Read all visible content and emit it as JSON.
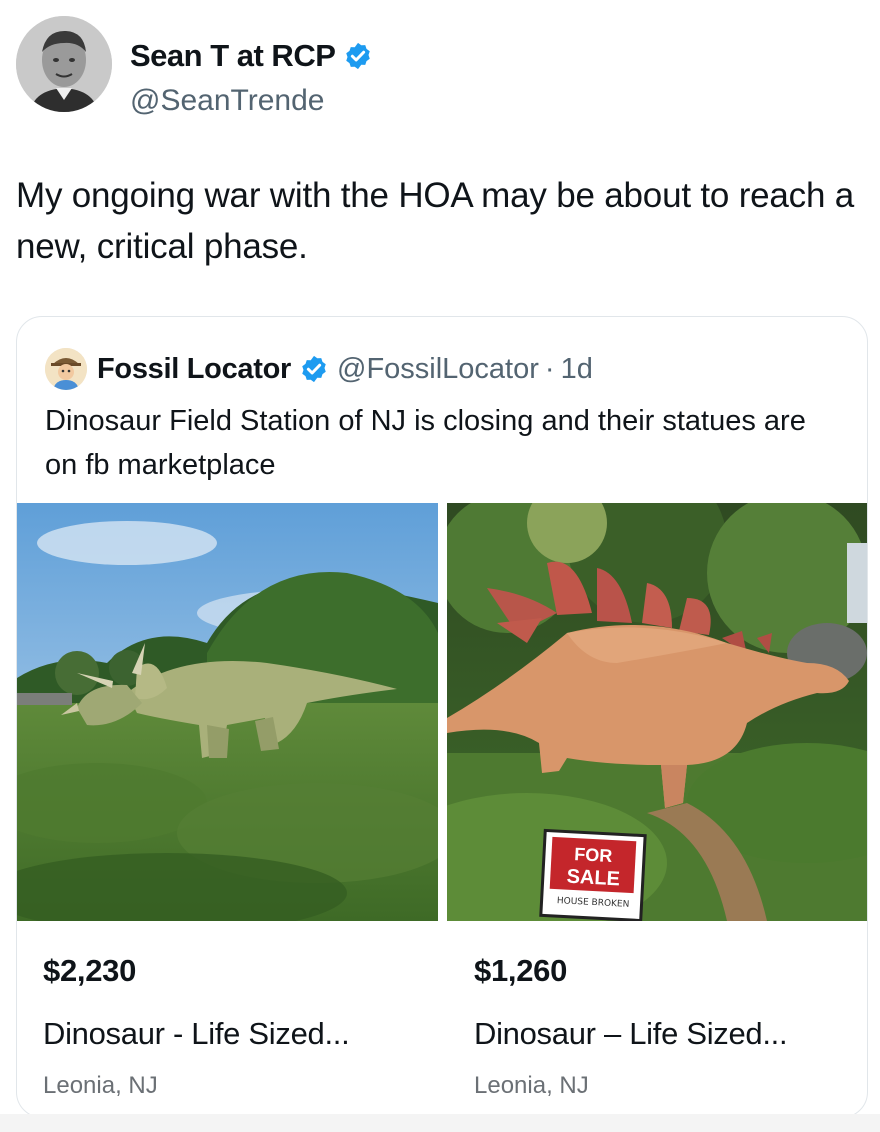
{
  "author": {
    "name": "Sean T at RCP",
    "handle": "@SeanTrende",
    "verified_color": "#1d9bf0"
  },
  "tweet": {
    "text": "My ongoing war with the HOA may be about to reach a new, critical phase."
  },
  "quoted_tweet": {
    "name": "Fossil Locator",
    "handle": "@FossilLocator",
    "separator": "·",
    "time": "1d",
    "text": "Dinosaur Field Station of NJ is closing and their statues are on fb marketplace",
    "listings": [
      {
        "price": "$2,230",
        "title": "Dinosaur - Life Sized...",
        "location": "Leonia, NJ",
        "image": "triceratops statue on grassy field"
      },
      {
        "price": "$1,260",
        "title": "Dinosaur – Life Sized...",
        "location": "Leonia, NJ",
        "image": "stegosaurus statue with for sale sign",
        "sign": {
          "line1": "FOR",
          "line2": "SALE",
          "note": "HOUSE BROKEN"
        }
      }
    ]
  }
}
